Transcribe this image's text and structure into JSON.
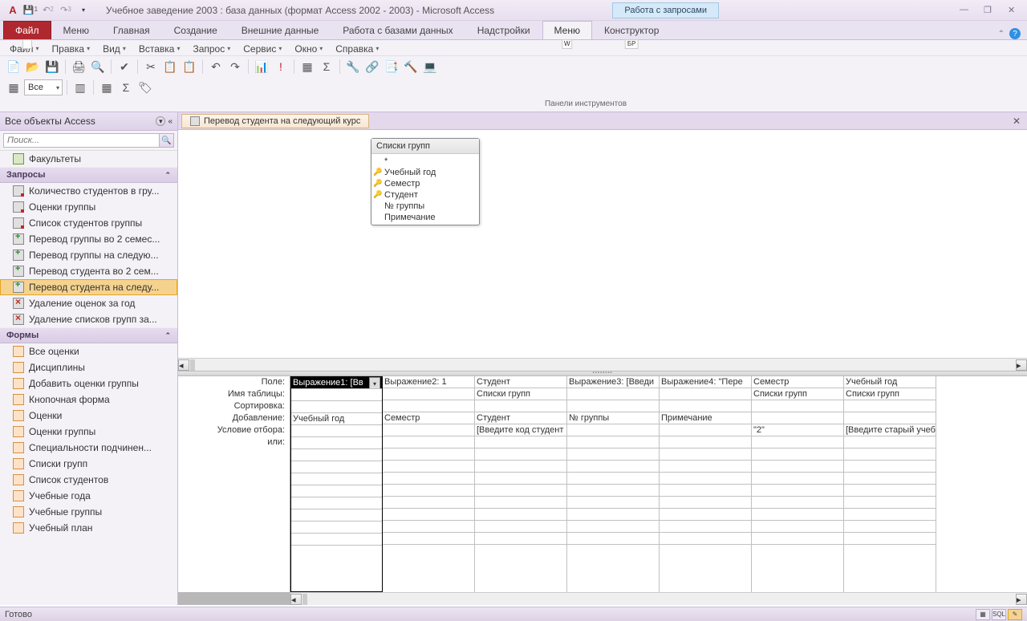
{
  "title": "Учебное заведение 2003 : база данных (формат Access 2002 - 2003)  -  Microsoft Access",
  "contextTab": "Работа с запросами",
  "ribbonTabs": [
    {
      "label": "Файл",
      "hotkey": "Ф",
      "cls": "file"
    },
    {
      "label": "Меню",
      "hotkey": ""
    },
    {
      "label": "Главная",
      "hotkey": ""
    },
    {
      "label": "Создание",
      "hotkey": ""
    },
    {
      "label": "Внешние данные",
      "hotkey": ""
    },
    {
      "label": "Работа с базами данных",
      "hotkey": ""
    },
    {
      "label": "Надстройки",
      "hotkey": ""
    },
    {
      "label": "Меню",
      "hotkey": "W",
      "cls": "active"
    },
    {
      "label": "Конструктор",
      "hotkey": "БР"
    }
  ],
  "menus": [
    "Файл",
    "Правка",
    "Вид",
    "Вставка",
    "Запрос",
    "Сервис",
    "Окно",
    "Справка"
  ],
  "menuHotkeys": [
    "Ф",
    "П",
    "В",
    "И",
    "Q",
    "Е",
    "О",
    "С"
  ],
  "comboAll": "Все",
  "panelLabel": "Панели инструментов",
  "nav": {
    "header": "Все объекты Access",
    "searchPlaceholder": "Поиск...",
    "tables": {
      "label": "",
      "items": [
        "Факультеты"
      ]
    },
    "queries": {
      "label": "Запросы",
      "items": [
        {
          "txt": "Количество студентов в гру...",
          "ico": "query"
        },
        {
          "txt": "Оценки группы",
          "ico": "query"
        },
        {
          "txt": "Список студентов группы",
          "ico": "query"
        },
        {
          "txt": "Перевод группы во 2 семес...",
          "ico": "append"
        },
        {
          "txt": "Перевод группы на следую...",
          "ico": "append"
        },
        {
          "txt": "Перевод студента во 2 сем...",
          "ico": "append"
        },
        {
          "txt": "Перевод студента на следу...",
          "ico": "append",
          "sel": true
        },
        {
          "txt": "Удаление оценок за год",
          "ico": "delete"
        },
        {
          "txt": "Удаление списков групп за...",
          "ico": "delete"
        }
      ]
    },
    "forms": {
      "label": "Формы",
      "items": [
        "Все оценки",
        "Дисциплины",
        "Добавить оценки группы",
        "Кнопочная форма",
        "Оценки",
        "Оценки группы",
        "Специальности подчинен...",
        "Списки групп",
        "Список студентов",
        "Учебные года",
        "Учебные группы",
        "Учебный план"
      ]
    }
  },
  "docTab": "Перевод студента на следующий курс",
  "tableBox": {
    "title": "Списки групп",
    "fields": [
      {
        "txt": "*",
        "key": false
      },
      {
        "txt": "Учебный год",
        "key": true
      },
      {
        "txt": "Семестр",
        "key": true
      },
      {
        "txt": "Студент",
        "key": true
      },
      {
        "txt": "№ группы",
        "key": false
      },
      {
        "txt": "Примечание",
        "key": false
      }
    ]
  },
  "gridLabels": [
    "Поле:",
    "Имя таблицы:",
    "Сортировка:",
    "Добавление:",
    "Условие отбора:",
    "или:"
  ],
  "gridCols": [
    {
      "field": "Выражение1: [Вв",
      "table": "",
      "sort": "",
      "append": "Учебный год",
      "crit": "",
      "or": ""
    },
    {
      "field": "Выражение2: 1",
      "table": "",
      "sort": "",
      "append": "Семестр",
      "crit": "",
      "or": ""
    },
    {
      "field": "Студент",
      "table": "Списки групп",
      "sort": "",
      "append": "Студент",
      "crit": "[Введите код студент",
      "or": ""
    },
    {
      "field": "Выражение3: [Введи",
      "table": "",
      "sort": "",
      "append": "№ группы",
      "crit": "",
      "or": ""
    },
    {
      "field": "Выражение4: \"Пере",
      "table": "",
      "sort": "",
      "append": "Примечание",
      "crit": "",
      "or": ""
    },
    {
      "field": "Семестр",
      "table": "Списки групп",
      "sort": "",
      "append": "",
      "crit": "\"2\"",
      "or": ""
    },
    {
      "field": "Учебный год",
      "table": "Списки групп",
      "sort": "",
      "append": "",
      "crit": "[Введите старый учеб",
      "or": ""
    }
  ],
  "status": "Готово"
}
